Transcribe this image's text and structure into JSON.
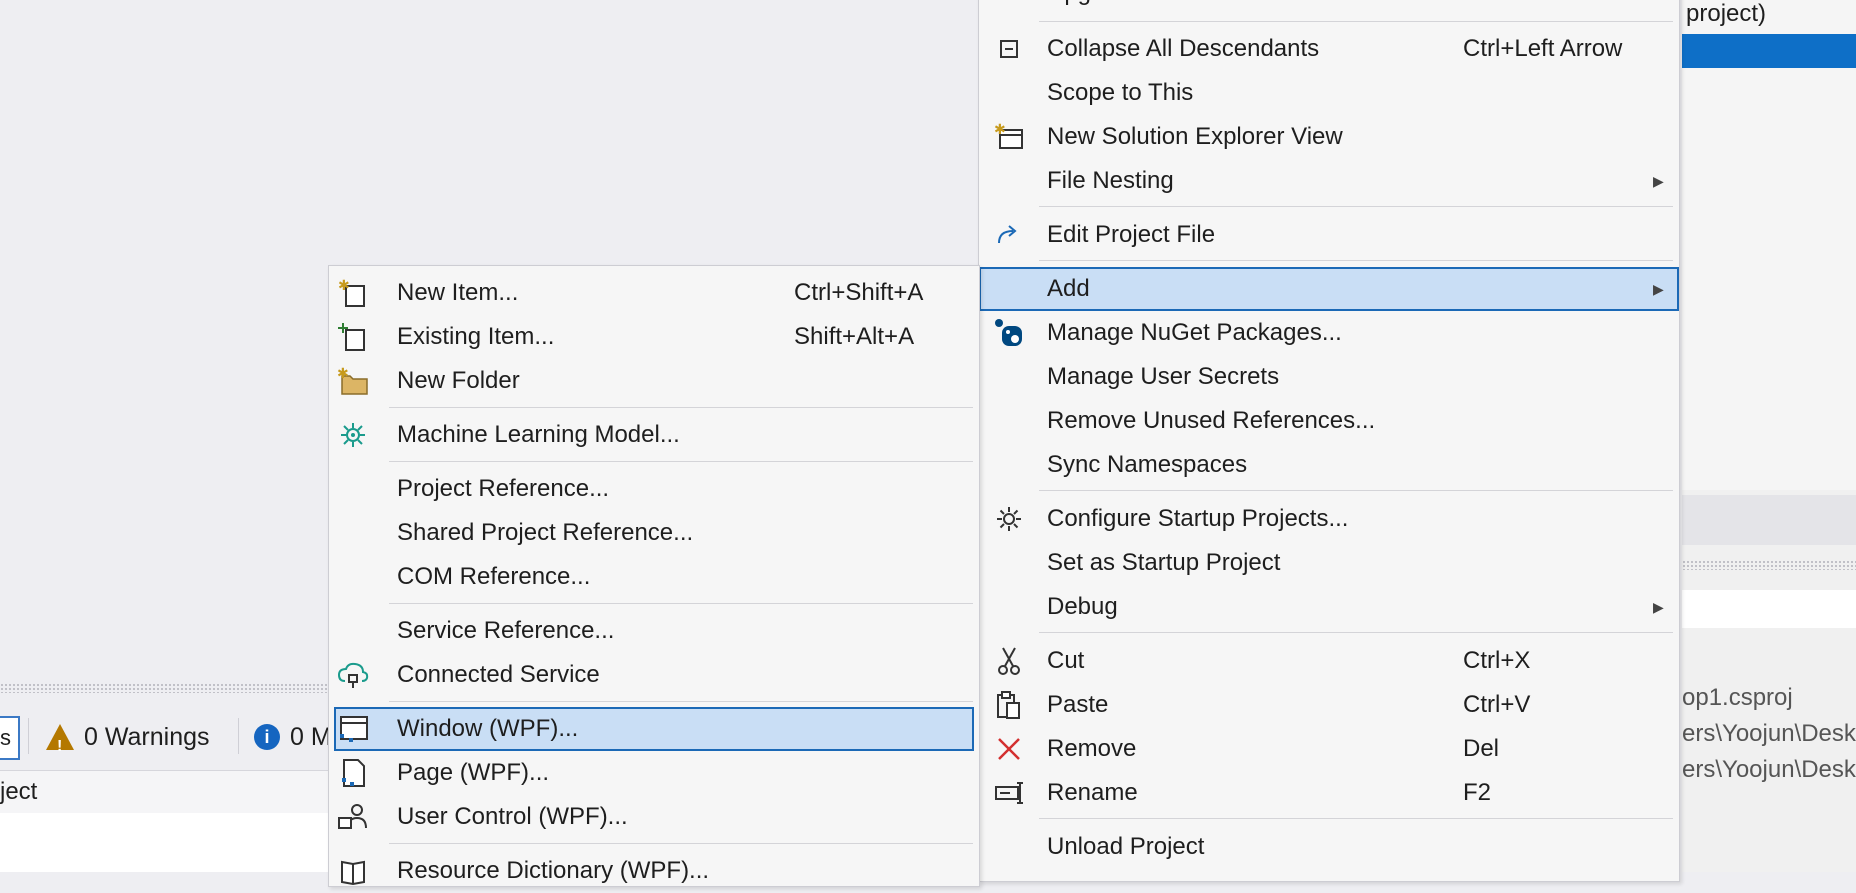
{
  "background": {
    "project_label": "project)",
    "prop_rows": [
      "op1.csproj",
      "ers\\Yoojun\\Desk",
      "ers\\Yoojun\\Desk"
    ],
    "error_list": {
      "left_btn": "s",
      "warnings": "0 Warnings",
      "messages": "0 M",
      "grid_header": "ject"
    }
  },
  "context_menu": {
    "items": [
      {
        "label": "Upgrade",
        "shortcut": "",
        "icon": ""
      },
      {
        "label": "Collapse All Descendants",
        "shortcut": "Ctrl+Left Arrow",
        "icon": "collapse-icon"
      },
      {
        "label": "Scope to This",
        "shortcut": "",
        "icon": ""
      },
      {
        "label": "New Solution Explorer View",
        "shortcut": "",
        "icon": "new-view-icon"
      },
      {
        "label": "File Nesting",
        "shortcut": "",
        "icon": "",
        "submenu": true
      },
      {
        "label": "Edit Project File",
        "shortcut": "",
        "icon": "redo-arrow-icon"
      },
      {
        "label": "Add",
        "shortcut": "",
        "icon": "",
        "submenu": true,
        "highlighted": true
      },
      {
        "label": "Manage NuGet Packages...",
        "shortcut": "",
        "icon": "nuget-icon"
      },
      {
        "label": "Manage User Secrets",
        "shortcut": "",
        "icon": ""
      },
      {
        "label": "Remove Unused References...",
        "shortcut": "",
        "icon": ""
      },
      {
        "label": "Sync Namespaces",
        "shortcut": "",
        "icon": ""
      },
      {
        "label": "Configure Startup Projects...",
        "shortcut": "",
        "icon": "gear-icon"
      },
      {
        "label": "Set as Startup Project",
        "shortcut": "",
        "icon": ""
      },
      {
        "label": "Debug",
        "shortcut": "",
        "icon": "",
        "submenu": true
      },
      {
        "label": "Cut",
        "shortcut": "Ctrl+X",
        "icon": "scissors-icon"
      },
      {
        "label": "Paste",
        "shortcut": "Ctrl+V",
        "icon": "clipboard-icon"
      },
      {
        "label": "Remove",
        "shortcut": "Del",
        "icon": "remove-x-icon"
      },
      {
        "label": "Rename",
        "shortcut": "F2",
        "icon": "rename-icon"
      },
      {
        "label": "Unload Project",
        "shortcut": "",
        "icon": ""
      }
    ]
  },
  "add_submenu": {
    "items": [
      {
        "label": "New Item...",
        "shortcut": "Ctrl+Shift+A",
        "icon": "new-item-icon"
      },
      {
        "label": "Existing Item...",
        "shortcut": "Shift+Alt+A",
        "icon": "existing-item-icon"
      },
      {
        "label": "New Folder",
        "shortcut": "",
        "icon": "new-folder-icon"
      },
      {
        "label": "Machine Learning Model...",
        "shortcut": "",
        "icon": "ml-model-icon"
      },
      {
        "label": "Project Reference...",
        "shortcut": "",
        "icon": ""
      },
      {
        "label": "Shared Project Reference...",
        "shortcut": "",
        "icon": ""
      },
      {
        "label": "COM Reference...",
        "shortcut": "",
        "icon": ""
      },
      {
        "label": "Service Reference...",
        "shortcut": "",
        "icon": ""
      },
      {
        "label": "Connected Service",
        "shortcut": "",
        "icon": "connected-service-icon"
      },
      {
        "label": "Window (WPF)...",
        "shortcut": "",
        "icon": "window-wpf-icon",
        "highlighted": true
      },
      {
        "label": "Page (WPF)...",
        "shortcut": "",
        "icon": "page-wpf-icon"
      },
      {
        "label": "User Control (WPF)...",
        "shortcut": "",
        "icon": "user-control-icon"
      },
      {
        "label": "Resource Dictionary (WPF)...",
        "shortcut": "",
        "icon": "resource-dictionary-icon"
      }
    ]
  },
  "colors": {
    "highlight_bg": "#c9def5",
    "highlight_border": "#1b69b6",
    "selection_blue": "#0e6fc7",
    "menu_bg": "#f6f6f6"
  }
}
